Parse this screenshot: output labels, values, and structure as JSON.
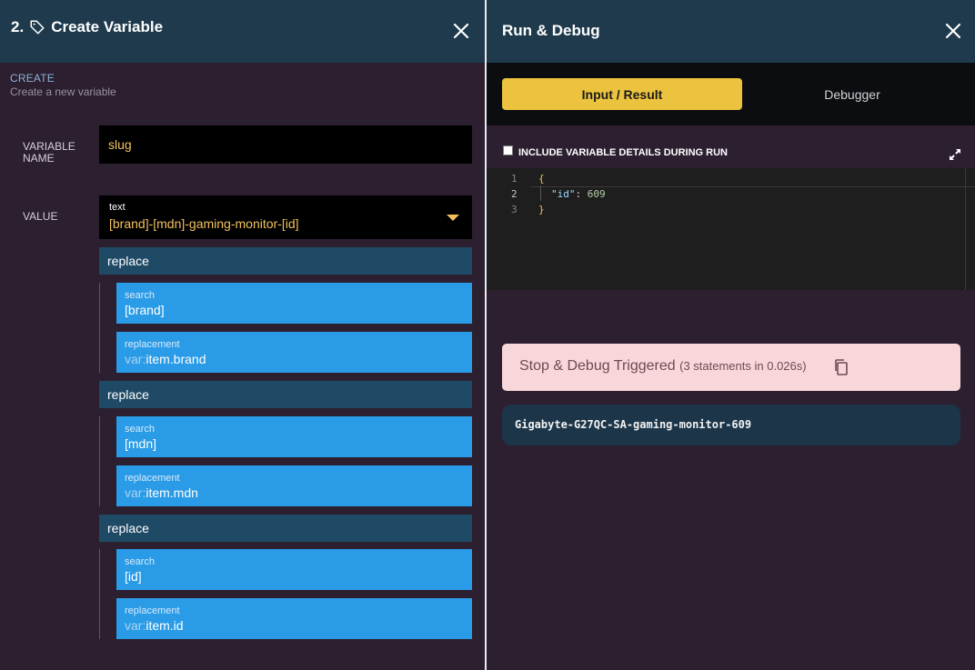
{
  "left_panel": {
    "step_number": "2.",
    "title": "Create Variable",
    "section_label": "CREATE",
    "section_subtitle": "Create a new variable",
    "variable_name_label": "VARIABLE NAME",
    "variable_name_value": "slug",
    "value_label": "VALUE",
    "value_type": "text",
    "value_text": "[brand]-[mdn]-gaming-monitor-[id]",
    "operations": [
      {
        "name": "replace",
        "search_label": "search",
        "search_value": "[brand]",
        "replacement_label": "replacement",
        "replacement_prefix": "var:",
        "replacement_value": "item.brand"
      },
      {
        "name": "replace",
        "search_label": "search",
        "search_value": "[mdn]",
        "replacement_label": "replacement",
        "replacement_prefix": "var:",
        "replacement_value": "item.mdn"
      },
      {
        "name": "replace",
        "search_label": "search",
        "search_value": "[id]",
        "replacement_label": "replacement",
        "replacement_prefix": "var:",
        "replacement_value": "item.id"
      }
    ]
  },
  "right_panel": {
    "title": "Run & Debug",
    "tabs": {
      "active": "Input / Result",
      "inactive": "Debugger"
    },
    "include_details_label": "INCLUDE VARIABLE DETAILS DURING RUN",
    "include_details_checked": false,
    "editor": {
      "line_numbers": [
        "1",
        "2",
        "3"
      ],
      "open_brace": "{",
      "key": "\"id\"",
      "colon": ": ",
      "value": "609",
      "close_brace": "}"
    },
    "alert": {
      "main": "Stop & Debug Triggered",
      "detail": "(3 statements in 0.026s)"
    },
    "result": "Gigabyte-G27QC-SA-gaming-monitor-609"
  },
  "colors": {
    "header_bg": "#1f3a4d",
    "panel_bg": "#2b1f30",
    "accent_yellow": "#ecc33e",
    "param_blue": "#2a9be6",
    "replace_bar": "#1f4a66",
    "alert_bg": "#f8d7da"
  },
  "icons": {
    "tag": "tag-icon",
    "close": "close-icon",
    "caret": "caret-down-icon",
    "expand": "expand-icon",
    "copy": "copy-icon"
  }
}
